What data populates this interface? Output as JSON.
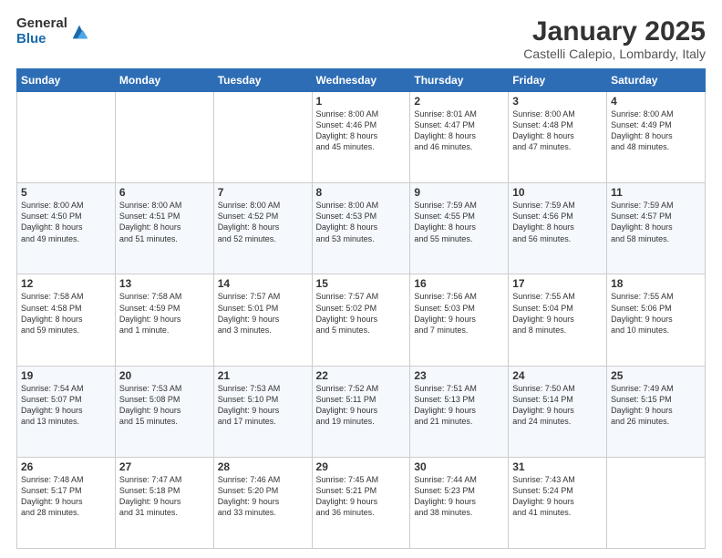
{
  "logo": {
    "general": "General",
    "blue": "Blue"
  },
  "header": {
    "month": "January 2025",
    "location": "Castelli Calepio, Lombardy, Italy"
  },
  "days_of_week": [
    "Sunday",
    "Monday",
    "Tuesday",
    "Wednesday",
    "Thursday",
    "Friday",
    "Saturday"
  ],
  "weeks": [
    [
      {
        "day": "",
        "info": ""
      },
      {
        "day": "",
        "info": ""
      },
      {
        "day": "",
        "info": ""
      },
      {
        "day": "1",
        "info": "Sunrise: 8:00 AM\nSunset: 4:46 PM\nDaylight: 8 hours\nand 45 minutes."
      },
      {
        "day": "2",
        "info": "Sunrise: 8:01 AM\nSunset: 4:47 PM\nDaylight: 8 hours\nand 46 minutes."
      },
      {
        "day": "3",
        "info": "Sunrise: 8:00 AM\nSunset: 4:48 PM\nDaylight: 8 hours\nand 47 minutes."
      },
      {
        "day": "4",
        "info": "Sunrise: 8:00 AM\nSunset: 4:49 PM\nDaylight: 8 hours\nand 48 minutes."
      }
    ],
    [
      {
        "day": "5",
        "info": "Sunrise: 8:00 AM\nSunset: 4:50 PM\nDaylight: 8 hours\nand 49 minutes."
      },
      {
        "day": "6",
        "info": "Sunrise: 8:00 AM\nSunset: 4:51 PM\nDaylight: 8 hours\nand 51 minutes."
      },
      {
        "day": "7",
        "info": "Sunrise: 8:00 AM\nSunset: 4:52 PM\nDaylight: 8 hours\nand 52 minutes."
      },
      {
        "day": "8",
        "info": "Sunrise: 8:00 AM\nSunset: 4:53 PM\nDaylight: 8 hours\nand 53 minutes."
      },
      {
        "day": "9",
        "info": "Sunrise: 7:59 AM\nSunset: 4:55 PM\nDaylight: 8 hours\nand 55 minutes."
      },
      {
        "day": "10",
        "info": "Sunrise: 7:59 AM\nSunset: 4:56 PM\nDaylight: 8 hours\nand 56 minutes."
      },
      {
        "day": "11",
        "info": "Sunrise: 7:59 AM\nSunset: 4:57 PM\nDaylight: 8 hours\nand 58 minutes."
      }
    ],
    [
      {
        "day": "12",
        "info": "Sunrise: 7:58 AM\nSunset: 4:58 PM\nDaylight: 8 hours\nand 59 minutes."
      },
      {
        "day": "13",
        "info": "Sunrise: 7:58 AM\nSunset: 4:59 PM\nDaylight: 9 hours\nand 1 minute."
      },
      {
        "day": "14",
        "info": "Sunrise: 7:57 AM\nSunset: 5:01 PM\nDaylight: 9 hours\nand 3 minutes."
      },
      {
        "day": "15",
        "info": "Sunrise: 7:57 AM\nSunset: 5:02 PM\nDaylight: 9 hours\nand 5 minutes."
      },
      {
        "day": "16",
        "info": "Sunrise: 7:56 AM\nSunset: 5:03 PM\nDaylight: 9 hours\nand 7 minutes."
      },
      {
        "day": "17",
        "info": "Sunrise: 7:55 AM\nSunset: 5:04 PM\nDaylight: 9 hours\nand 8 minutes."
      },
      {
        "day": "18",
        "info": "Sunrise: 7:55 AM\nSunset: 5:06 PM\nDaylight: 9 hours\nand 10 minutes."
      }
    ],
    [
      {
        "day": "19",
        "info": "Sunrise: 7:54 AM\nSunset: 5:07 PM\nDaylight: 9 hours\nand 13 minutes."
      },
      {
        "day": "20",
        "info": "Sunrise: 7:53 AM\nSunset: 5:08 PM\nDaylight: 9 hours\nand 15 minutes."
      },
      {
        "day": "21",
        "info": "Sunrise: 7:53 AM\nSunset: 5:10 PM\nDaylight: 9 hours\nand 17 minutes."
      },
      {
        "day": "22",
        "info": "Sunrise: 7:52 AM\nSunset: 5:11 PM\nDaylight: 9 hours\nand 19 minutes."
      },
      {
        "day": "23",
        "info": "Sunrise: 7:51 AM\nSunset: 5:13 PM\nDaylight: 9 hours\nand 21 minutes."
      },
      {
        "day": "24",
        "info": "Sunrise: 7:50 AM\nSunset: 5:14 PM\nDaylight: 9 hours\nand 24 minutes."
      },
      {
        "day": "25",
        "info": "Sunrise: 7:49 AM\nSunset: 5:15 PM\nDaylight: 9 hours\nand 26 minutes."
      }
    ],
    [
      {
        "day": "26",
        "info": "Sunrise: 7:48 AM\nSunset: 5:17 PM\nDaylight: 9 hours\nand 28 minutes."
      },
      {
        "day": "27",
        "info": "Sunrise: 7:47 AM\nSunset: 5:18 PM\nDaylight: 9 hours\nand 31 minutes."
      },
      {
        "day": "28",
        "info": "Sunrise: 7:46 AM\nSunset: 5:20 PM\nDaylight: 9 hours\nand 33 minutes."
      },
      {
        "day": "29",
        "info": "Sunrise: 7:45 AM\nSunset: 5:21 PM\nDaylight: 9 hours\nand 36 minutes."
      },
      {
        "day": "30",
        "info": "Sunrise: 7:44 AM\nSunset: 5:23 PM\nDaylight: 9 hours\nand 38 minutes."
      },
      {
        "day": "31",
        "info": "Sunrise: 7:43 AM\nSunset: 5:24 PM\nDaylight: 9 hours\nand 41 minutes."
      },
      {
        "day": "",
        "info": ""
      }
    ]
  ]
}
